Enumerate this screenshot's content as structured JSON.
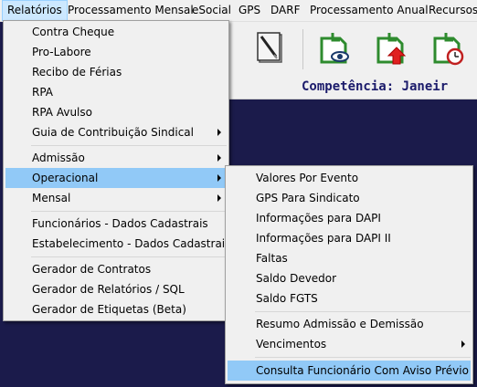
{
  "menubar": {
    "items": [
      {
        "label": "Relatórios"
      },
      {
        "label": "Processamento Mensal"
      },
      {
        "label": "eSocial"
      },
      {
        "label": "GPS"
      },
      {
        "label": "DARF"
      },
      {
        "label": "Processamento Anual"
      },
      {
        "label": "Recursos H"
      }
    ]
  },
  "toolbar": {
    "icons": [
      "edit-document-icon",
      "view-document-icon",
      "upload-document-icon",
      "schedule-document-icon"
    ]
  },
  "competencia": {
    "text": "Competência: Janeir"
  },
  "relatorios_menu": {
    "items": [
      {
        "label": "Contra Cheque"
      },
      {
        "label": "Pro-Labore"
      },
      {
        "label": "Recibo de Férias"
      },
      {
        "label": "RPA"
      },
      {
        "label": "RPA Avulso"
      },
      {
        "label": "Guia de Contribuição Sindical"
      },
      {
        "label": "Admissão"
      },
      {
        "label": "Operacional"
      },
      {
        "label": "Mensal"
      },
      {
        "label": "Funcionários - Dados Cadastrais"
      },
      {
        "label": "Estabelecimento - Dados Cadastrais"
      },
      {
        "label": "Gerador de Contratos"
      },
      {
        "label": "Gerador de Relatórios / SQL"
      },
      {
        "label": "Gerador de Etiquetas (Beta)"
      }
    ]
  },
  "operacional_menu": {
    "items": [
      {
        "label": "Valores Por Evento"
      },
      {
        "label": "GPS Para Sindicato"
      },
      {
        "label": "Informações para DAPI"
      },
      {
        "label": "Informações para DAPI II"
      },
      {
        "label": "Faltas"
      },
      {
        "label": "Saldo Devedor"
      },
      {
        "label": "Saldo FGTS"
      },
      {
        "label": "Resumo Admissão e Demissão"
      },
      {
        "label": "Vencimentos"
      },
      {
        "label": "Consulta Funcionário Com Aviso Prévio"
      }
    ]
  },
  "colors": {
    "accent": "#91c9f7",
    "background": "#1b1b4b",
    "competencia_text": "#1b1b6b"
  }
}
